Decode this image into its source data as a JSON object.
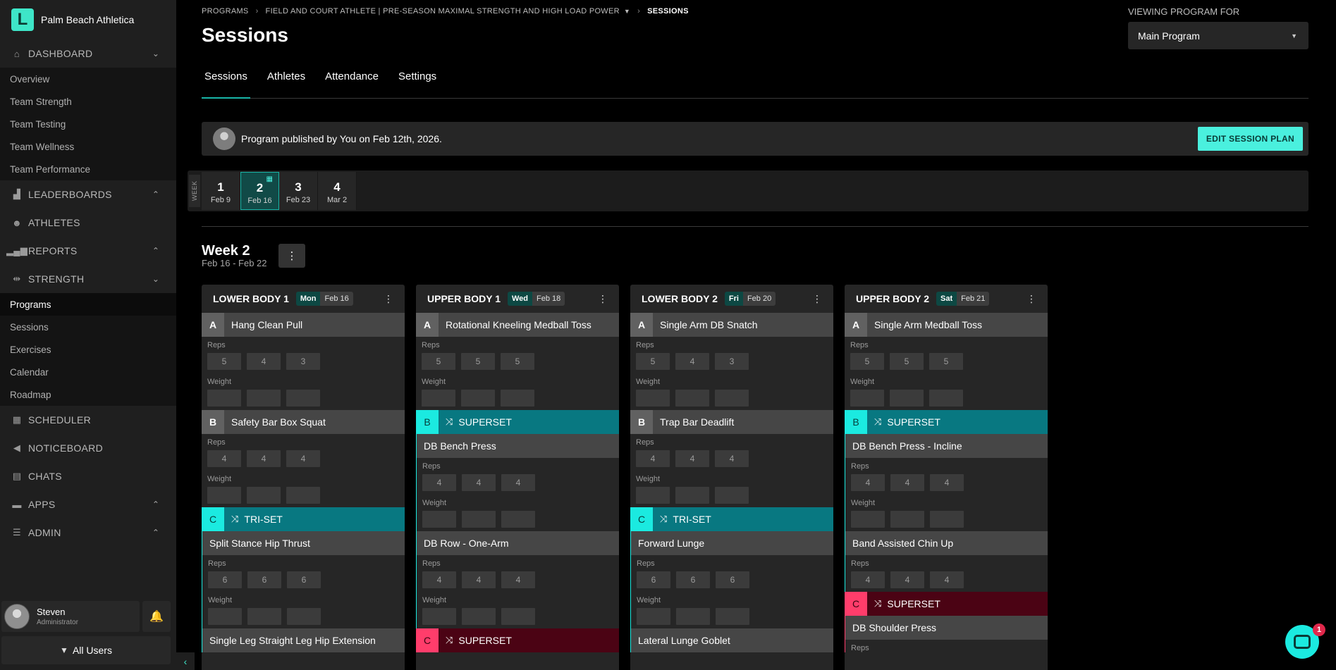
{
  "brand": {
    "name": "Palm Beach Athletica",
    "logo_letter": "L"
  },
  "sidebar": {
    "dashboard": {
      "label": "DASHBOARD",
      "items": [
        "Overview",
        "Team Strength",
        "Team Testing",
        "Team Wellness",
        "Team Performance"
      ]
    },
    "leaderboards": {
      "label": "LEADERBOARDS"
    },
    "athletes": {
      "label": "ATHLETES"
    },
    "reports": {
      "label": "REPORTS"
    },
    "strength": {
      "label": "STRENGTH",
      "items": [
        "Programs",
        "Sessions",
        "Exercises",
        "Calendar",
        "Roadmap"
      ]
    },
    "scheduler": {
      "label": "SCHEDULER"
    },
    "noticeboard": {
      "label": "NOTICEBOARD"
    },
    "chats": {
      "label": "CHATS"
    },
    "apps": {
      "label": "APPS"
    },
    "admin": {
      "label": "ADMIN"
    }
  },
  "user": {
    "name": "Steven",
    "role": "Administrator",
    "filter_label": "All Users"
  },
  "breadcrumb": {
    "root": "PROGRAMS",
    "program": "FIELD AND COURT ATHLETE | PRE-SEASON MAXIMAL STRENGTH AND HIGH LOAD POWER",
    "current": "SESSIONS"
  },
  "page": {
    "title": "Sessions"
  },
  "viewing": {
    "label": "VIEWING PROGRAM FOR",
    "value": "Main Program"
  },
  "tabs": [
    "Sessions",
    "Athletes",
    "Attendance",
    "Settings"
  ],
  "publish": {
    "text": "Program published by You on Feb 12th, 2026.",
    "button": "EDIT SESSION PLAN"
  },
  "weeks": {
    "label": "WEEK",
    "items": [
      {
        "num": "1",
        "date": "Feb 9"
      },
      {
        "num": "2",
        "date": "Feb 16"
      },
      {
        "num": "3",
        "date": "Feb 23"
      },
      {
        "num": "4",
        "date": "Mar 2"
      }
    ]
  },
  "current_week": {
    "title": "Week 2",
    "range": "Feb 16 - Feb 22",
    "menu": "⋮"
  },
  "sessions": [
    {
      "name": "LOWER BODY 1",
      "day": "Mon",
      "date": "Feb 16",
      "a": {
        "letter": "A",
        "name": "Hang Clean Pull",
        "reps": [
          "5",
          "4",
          "3"
        ]
      },
      "b": {
        "letter": "B",
        "name": "Safety Bar Box Squat",
        "reps": [
          "4",
          "4",
          "4"
        ]
      },
      "c": {
        "letter": "C",
        "label": "TRI-SET",
        "ex1": {
          "name": "Split Stance Hip Thrust",
          "reps": [
            "6",
            "6",
            "6"
          ]
        },
        "ex2": {
          "name": "Single Leg Straight Leg Hip Extension"
        }
      }
    },
    {
      "name": "UPPER BODY 1",
      "day": "Wed",
      "date": "Feb 18",
      "a": {
        "letter": "A",
        "name": "Rotational Kneeling Medball Toss",
        "reps": [
          "5",
          "5",
          "5"
        ]
      },
      "b": {
        "letter": "B",
        "label": "SUPERSET",
        "ex1": {
          "name": "DB Bench Press",
          "reps": [
            "4",
            "4",
            "4"
          ]
        },
        "ex2": {
          "name": "DB Row - One-Arm",
          "reps": [
            "4",
            "4",
            "4"
          ]
        }
      },
      "c": {
        "letter": "C",
        "label": "SUPERSET"
      }
    },
    {
      "name": "LOWER BODY 2",
      "day": "Fri",
      "date": "Feb 20",
      "a": {
        "letter": "A",
        "name": "Single Arm DB Snatch",
        "reps": [
          "5",
          "4",
          "3"
        ]
      },
      "b": {
        "letter": "B",
        "name": "Trap Bar Deadlift",
        "reps": [
          "4",
          "4",
          "4"
        ]
      },
      "c": {
        "letter": "C",
        "label": "TRI-SET",
        "ex1": {
          "name": "Forward Lunge",
          "reps": [
            "6",
            "6",
            "6"
          ]
        },
        "ex2": {
          "name": "Lateral Lunge Goblet"
        }
      }
    },
    {
      "name": "UPPER BODY 2",
      "day": "Sat",
      "date": "Feb 21",
      "a": {
        "letter": "A",
        "name": "Single Arm Medball Toss",
        "reps": [
          "5",
          "5",
          "5"
        ]
      },
      "b": {
        "letter": "B",
        "label": "SUPERSET",
        "ex1": {
          "name": "DB Bench Press - Incline",
          "reps": [
            "4",
            "4",
            "4"
          ]
        },
        "ex2": {
          "name": "Band Assisted Chin Up",
          "reps": [
            "4",
            "4",
            "4"
          ]
        }
      },
      "c": {
        "letter": "C",
        "label": "SUPERSET",
        "ex1": {
          "name": "DB Shoulder Press"
        }
      }
    }
  ],
  "labels": {
    "reps": "Reps",
    "weight": "Weight"
  },
  "chat": {
    "badge": "1"
  },
  "colors": {
    "accent": "#4af0de",
    "teal_group": "#087881",
    "red_group": "#4b0314"
  }
}
